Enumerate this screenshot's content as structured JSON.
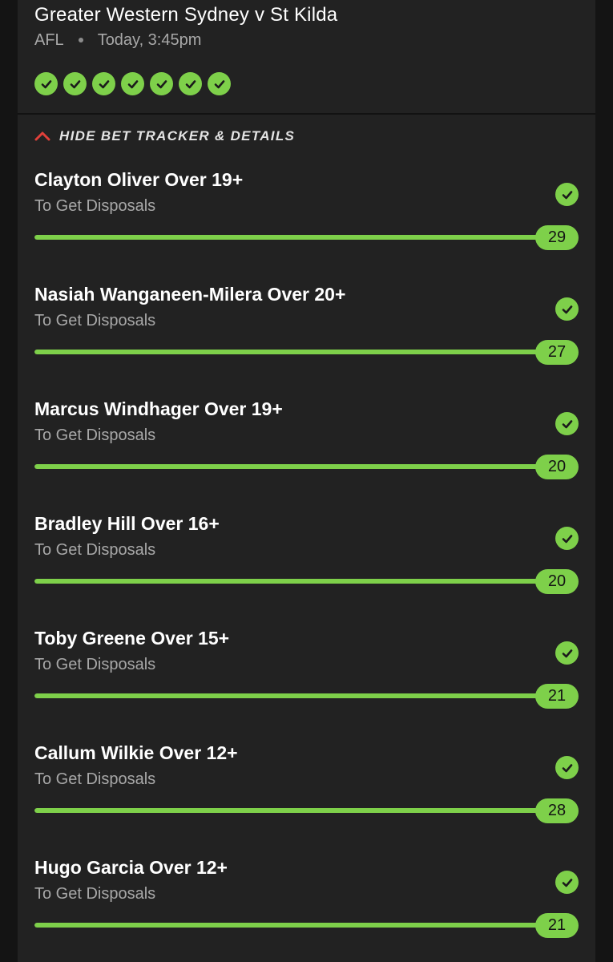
{
  "event": {
    "title": "Greater Western Sydney v St Kilda",
    "sport": "AFL",
    "time": "Today, 3:45pm"
  },
  "colors": {
    "accent": "#7ed04a",
    "background": "#141414",
    "card": "#222222",
    "toggle_chevron": "#e0403a"
  },
  "tracker": {
    "toggle_label": "HIDE BET TRACKER & DETAILS",
    "toggle_icon": "chevron-up-icon"
  },
  "legs": [
    {
      "name": "Clayton Oliver Over 19+",
      "market": "To Get Disposals",
      "result": "29",
      "status": "won",
      "progress": 1.0
    },
    {
      "name": "Nasiah Wanganeen-Milera Over 20+",
      "market": "To Get Disposals",
      "result": "27",
      "status": "won",
      "progress": 1.0
    },
    {
      "name": "Marcus Windhager Over 19+",
      "market": "To Get Disposals",
      "result": "20",
      "status": "won",
      "progress": 1.0
    },
    {
      "name": "Bradley Hill Over 16+",
      "market": "To Get Disposals",
      "result": "20",
      "status": "won",
      "progress": 1.0
    },
    {
      "name": "Toby Greene Over 15+",
      "market": "To Get Disposals",
      "result": "21",
      "status": "won",
      "progress": 1.0
    },
    {
      "name": "Callum Wilkie Over 12+",
      "market": "To Get Disposals",
      "result": "28",
      "status": "won",
      "progress": 1.0
    },
    {
      "name": "Hugo Garcia Over 12+",
      "market": "To Get Disposals",
      "result": "21",
      "status": "won",
      "progress": 1.0
    }
  ]
}
